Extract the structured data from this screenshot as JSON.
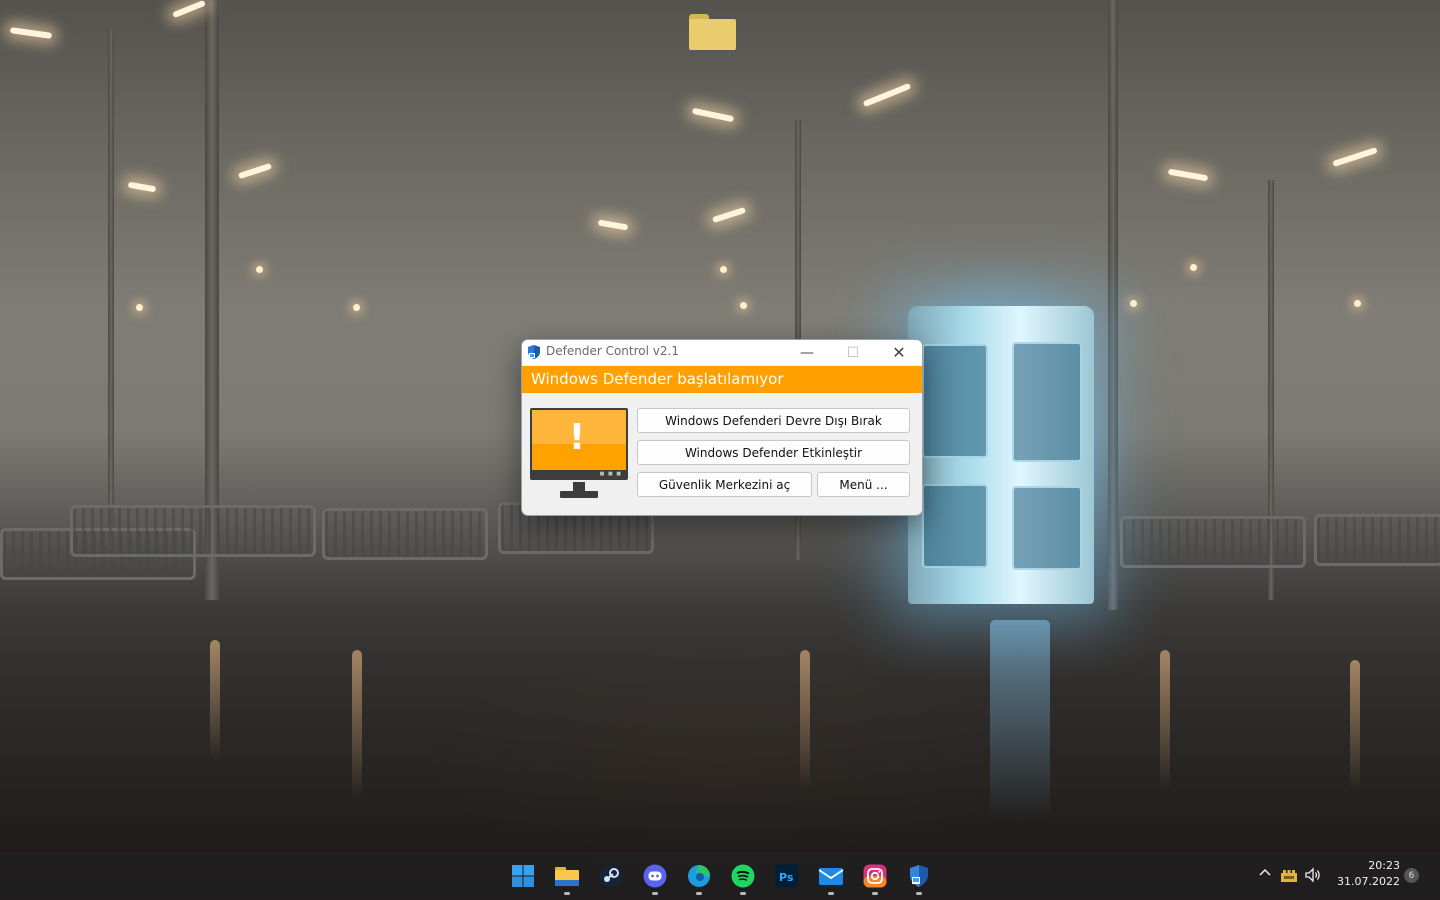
{
  "desktop": {
    "folder_icon": "folder-icon"
  },
  "window": {
    "title": "Defender Control v2.1",
    "controls": {
      "minimize": "—",
      "maximize": "☐",
      "close": "✕"
    },
    "status_message": "Windows Defender başlatılamıyor",
    "status_color": "#ff9f00",
    "status_icon": "warning-monitor-icon",
    "buttons": {
      "disable": "Windows Defenderi Devre Dışı Bırak",
      "enable": "Windows Defender Etkinleştir",
      "security_center": "Güvenlik Merkezini aç",
      "menu": "Menü ..."
    }
  },
  "taskbar": {
    "apps": [
      {
        "name": "start-icon",
        "running": false
      },
      {
        "name": "file-explorer-icon",
        "running": true
      },
      {
        "name": "steam-icon",
        "running": false
      },
      {
        "name": "discord-icon",
        "running": true
      },
      {
        "name": "edge-icon",
        "running": true
      },
      {
        "name": "spotify-icon",
        "running": true
      },
      {
        "name": "photoshop-icon",
        "running": false
      },
      {
        "name": "mail-icon",
        "running": true
      },
      {
        "name": "instagram-icon",
        "running": true
      },
      {
        "name": "defender-control-icon",
        "running": true
      }
    ],
    "tray": {
      "time": "20:23",
      "date": "31.07.2022",
      "notification_count": "6"
    }
  }
}
